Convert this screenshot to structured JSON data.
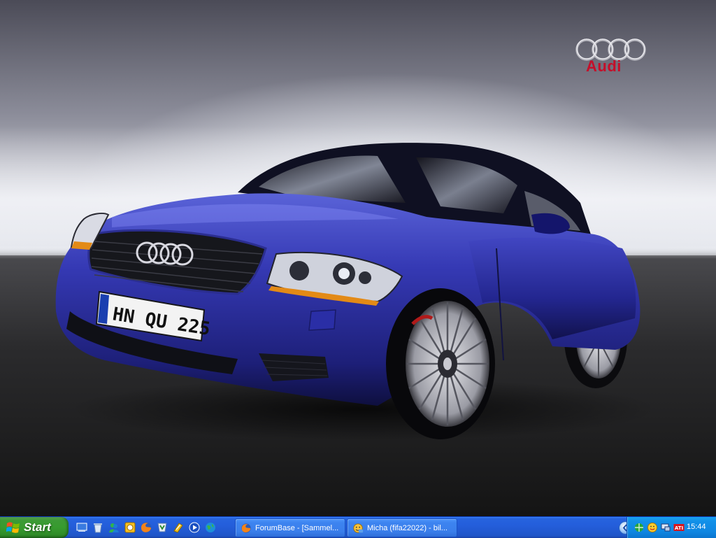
{
  "wallpaper": {
    "brand_text": "Audi",
    "license_plate": "HN QU 225",
    "plate_prefix": "HN",
    "plate_suffix": "QU 225",
    "car_color": "#2a2f9e"
  },
  "taskbar": {
    "start_label": "Start",
    "quicklaunch": [
      "show-desktop-icon",
      "recycle-icon",
      "messenger-icon",
      "media-icon",
      "firefox-icon",
      "winamp-icon",
      "music-icon",
      "player-icon",
      "globe-icon"
    ],
    "tasks": [
      {
        "label": "ForumBase - [Sammel...",
        "icon": "firefox-icon"
      },
      {
        "label": "Micha (fifa22022) - bil...",
        "icon": "messenger-icon"
      }
    ],
    "tray_icons": [
      "network-icon",
      "smiley-icon",
      "display-icon",
      "ati-icon"
    ],
    "ati_label": "ATI",
    "clock": "15:44"
  },
  "colors": {
    "taskbar_blue": "#245edb",
    "start_green": "#379b2f",
    "tray_blue": "#0f86e1",
    "audi_red": "#c40f2a"
  }
}
